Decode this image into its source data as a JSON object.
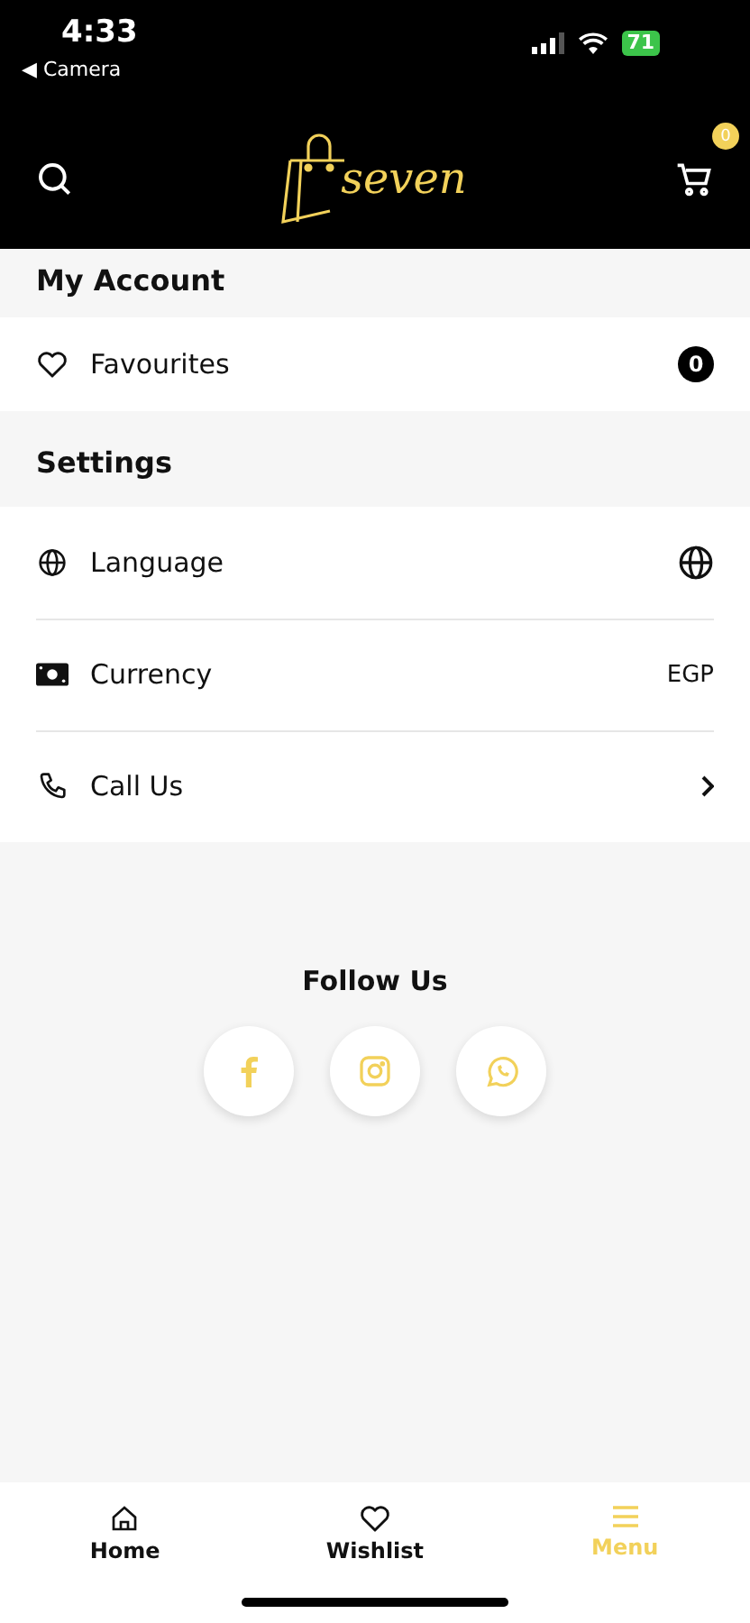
{
  "status_bar": {
    "time": "4:33",
    "back_label": "◀ Camera",
    "battery": "71"
  },
  "header": {
    "logo_text": "seven",
    "cart_badge": "0"
  },
  "sections": [
    {
      "title": "My Account",
      "rows": [
        {
          "label": "Favourites",
          "kind": "count",
          "value": "0"
        }
      ]
    },
    {
      "title": "Settings",
      "rows": [
        {
          "label": "Language",
          "kind": "globe"
        },
        {
          "label": "Currency",
          "kind": "value",
          "value": "EGP"
        },
        {
          "label": "Call Us",
          "kind": "chevron"
        }
      ]
    }
  ],
  "follow": {
    "title": "Follow Us",
    "links": [
      {
        "kind": "facebook"
      },
      {
        "kind": "instagram"
      },
      {
        "kind": "whatsapp"
      }
    ]
  },
  "bottom_nav": [
    {
      "label": "Home",
      "selected": false
    },
    {
      "label": "Wishlist",
      "selected": false
    },
    {
      "label": "Menu",
      "selected": true
    }
  ]
}
